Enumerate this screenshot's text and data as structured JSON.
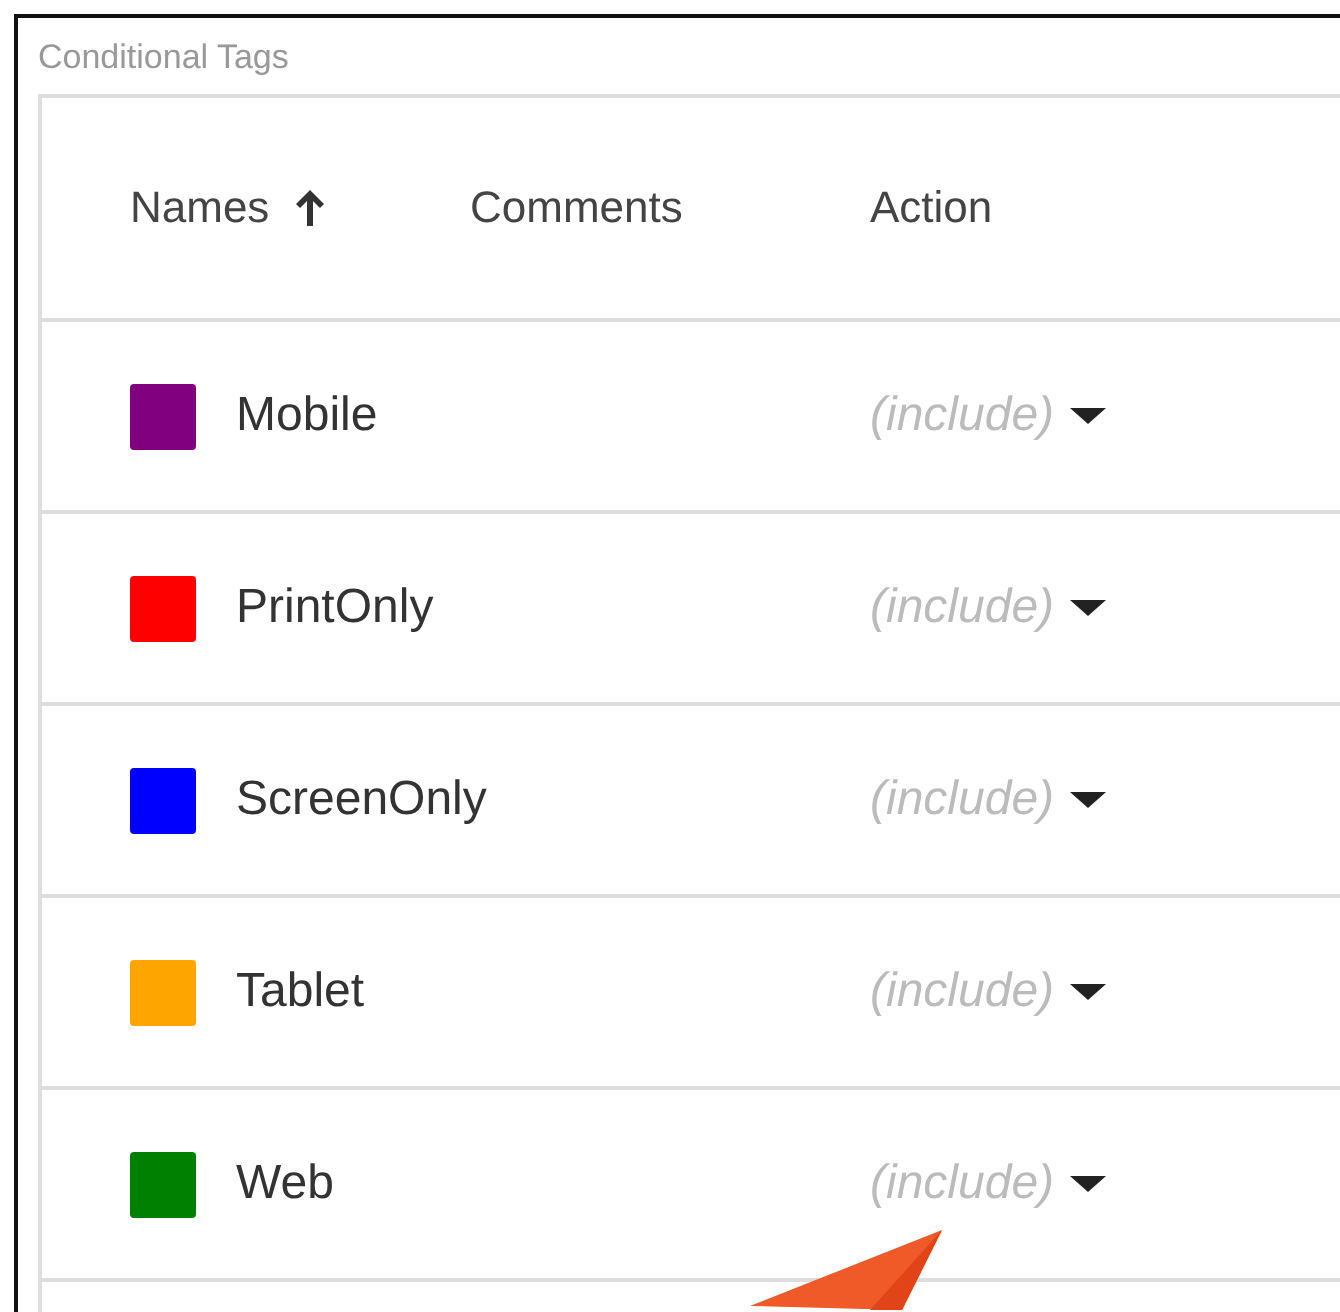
{
  "panel": {
    "title": "Conditional Tags"
  },
  "table": {
    "columns": [
      {
        "label": "Names",
        "sorted": true
      },
      {
        "label": "Comments",
        "sorted": false
      },
      {
        "label": "Action",
        "sorted": false
      }
    ],
    "rows": [
      {
        "name": "Mobile",
        "color": "#800080",
        "action": "(include)"
      },
      {
        "name": "PrintOnly",
        "color": "#ff0000",
        "action": "(include)"
      },
      {
        "name": "ScreenOnly",
        "color": "#0000ff",
        "action": "(include)"
      },
      {
        "name": "Tablet",
        "color": "#ffa500",
        "action": "(include)"
      },
      {
        "name": "Web",
        "color": "#008000",
        "action": "(include)"
      }
    ]
  }
}
